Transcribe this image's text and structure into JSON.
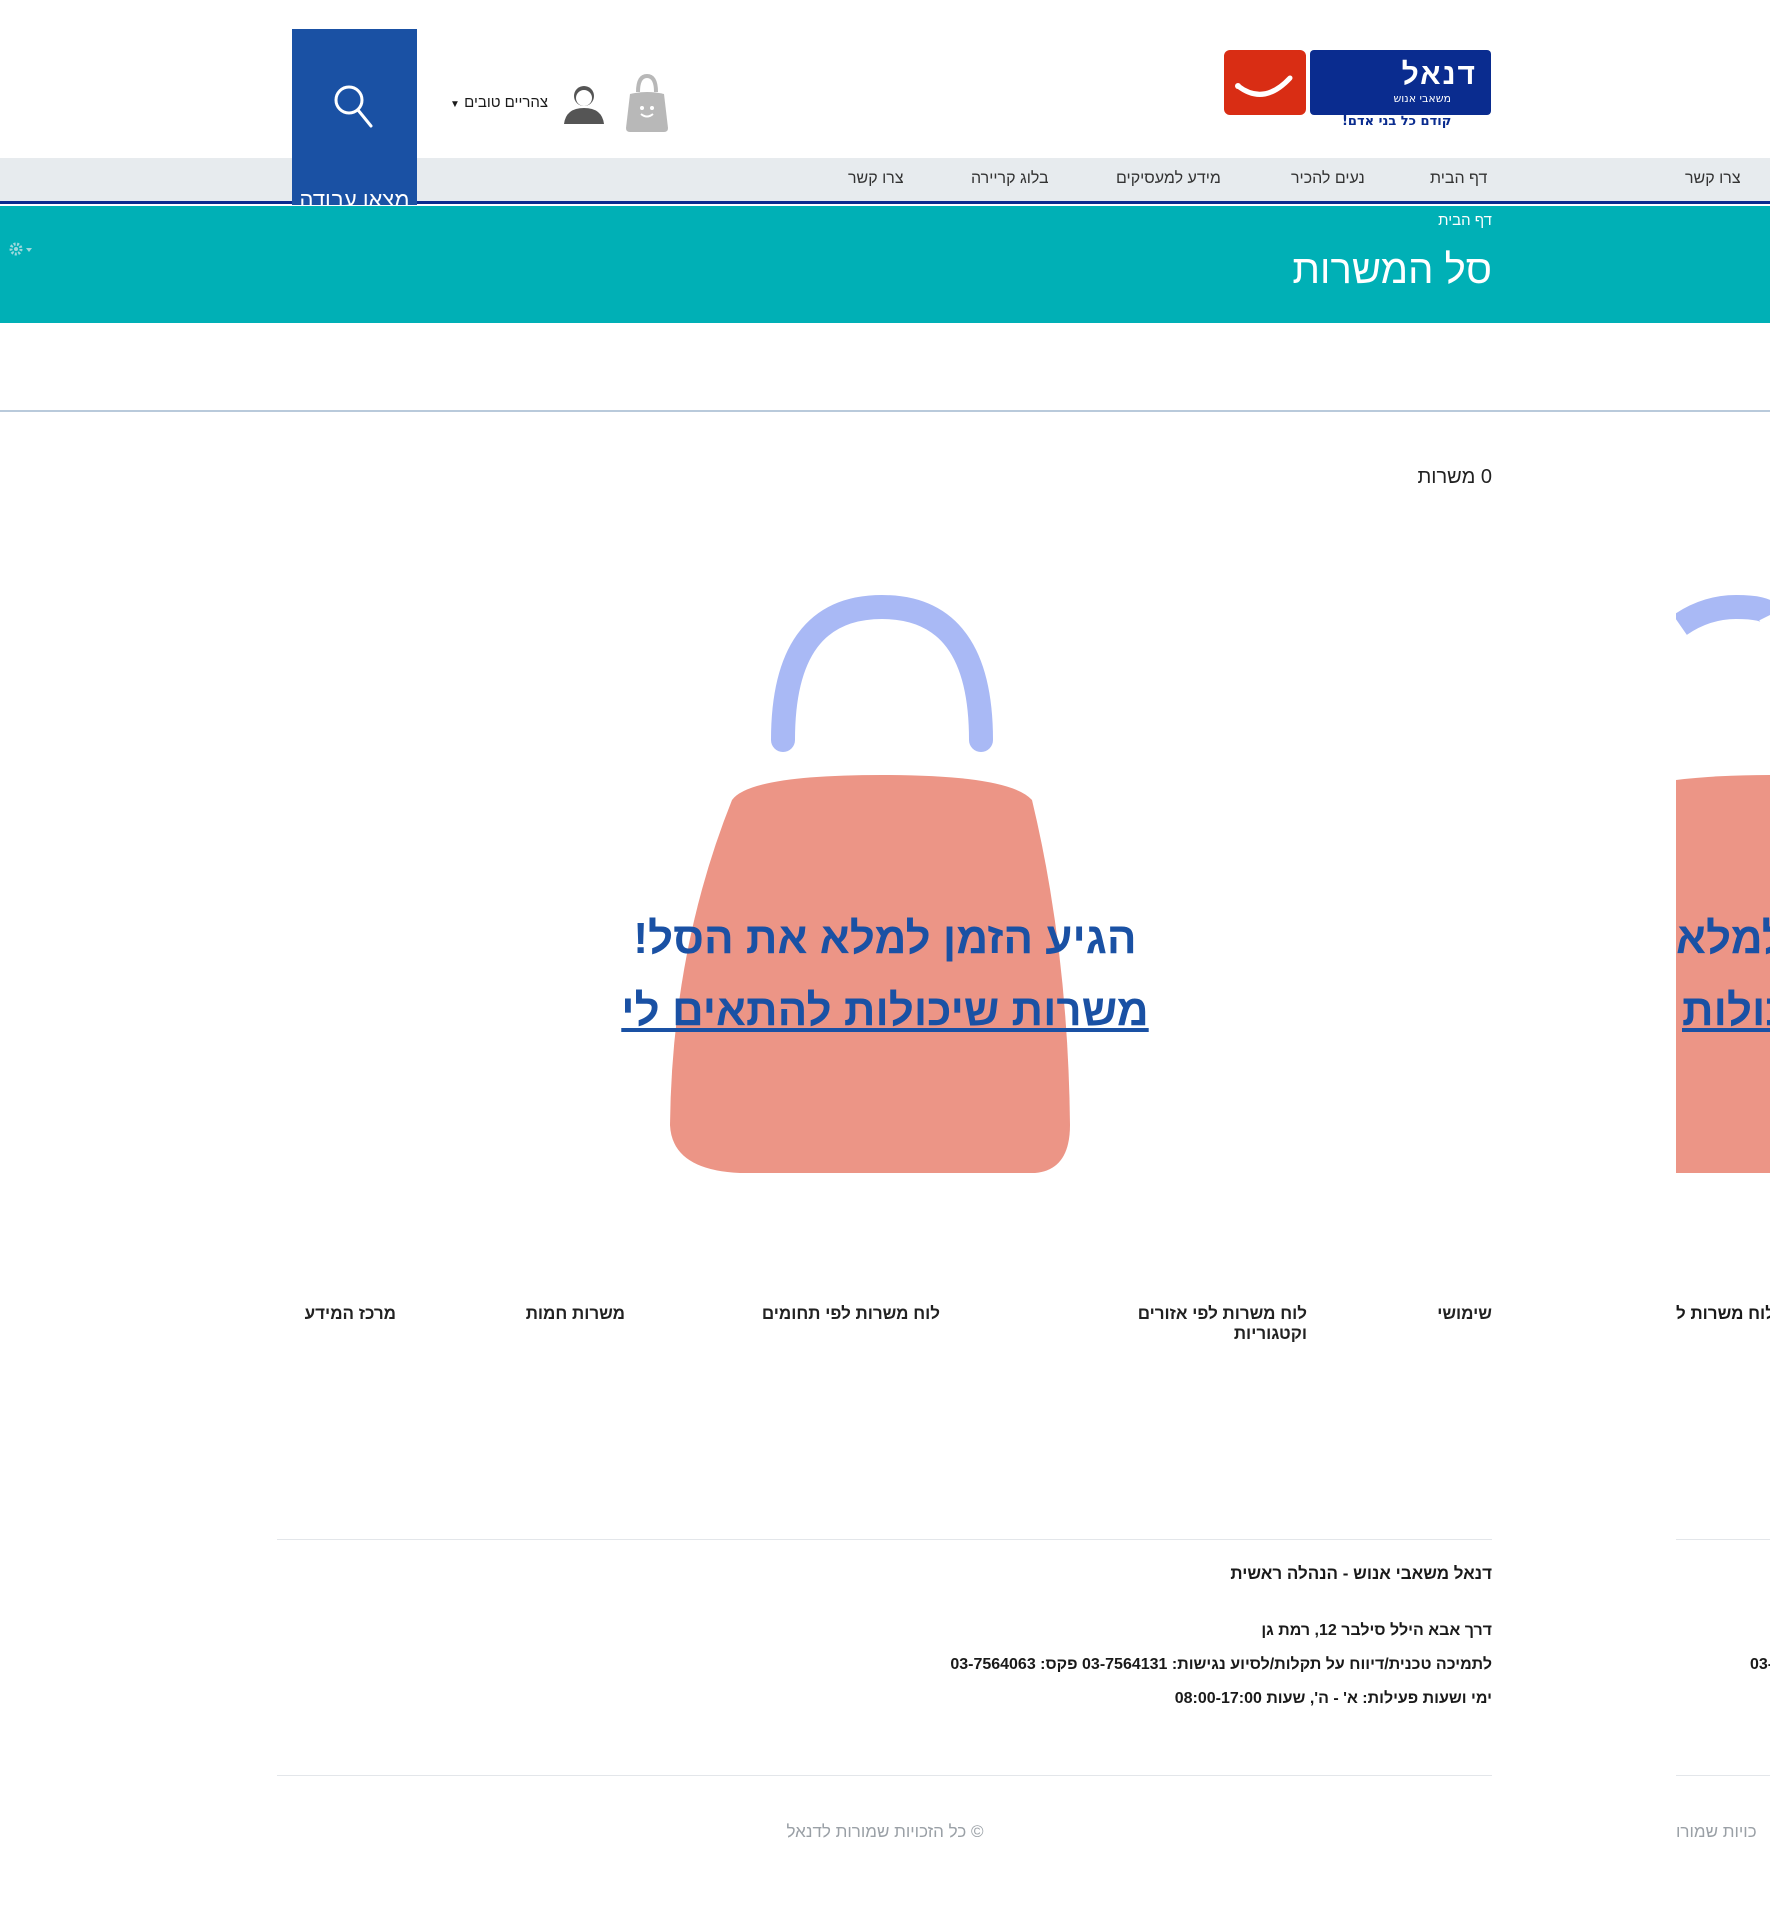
{
  "header": {
    "logo_brand": "דנאל",
    "logo_sub": "משאבי אנוש",
    "logo_tagline": "קודם כל בני אדם!",
    "greeting": "צהריים טובים",
    "find_job": "מצאו עבודה"
  },
  "nav": {
    "items": [
      "דף הבית",
      "נעים להכיר",
      "מידע למעסיקים",
      "בלוג קריירה",
      "צרו קשר"
    ],
    "far_right": "צרו קשר"
  },
  "page": {
    "breadcrumb": "דף הבית",
    "title": "סל המשרות",
    "job_count": "0 משרות"
  },
  "empty_state": {
    "title": "הגיע הזמן למלא את הסל!",
    "link": "משרות שיכולות להתאים לי"
  },
  "footer": {
    "links": [
      "שימושי",
      "לוח משרות לפי אזורים וקטגוריות",
      "לוח משרות לפי תחומים",
      "משרות חמות",
      "מרכז המידע"
    ],
    "company": "דנאל משאבי אנוש - הנהלה ראשית",
    "address": "דרך אבא הילל סילבר 12, רמת גן",
    "support": "לתמיכה טכנית/דיווח על תקלות/לסיוע נגישות: 03-7564131 פקס: 03-7564063",
    "hours": "ימי ושעות פעילות: א' - ה', שעות 08:00-17:00",
    "copyright": "© כל הזכויות שמורות לדנאל"
  },
  "ghost": {
    "link_fragment": "לוח משרות ל",
    "title_fragment": "למלא",
    "link2_fragment": "כולות",
    "phone_fragment": "03-",
    "copyright_fragment": "כויות שמורו"
  },
  "colors": {
    "brand_blue": "#0a2c8f",
    "button_blue": "#1a51a4",
    "teal": "#00b0b6",
    "bag_body": "#ec9586",
    "bag_handle": "#a9b9f5",
    "smile_red": "#d92d14"
  },
  "icons": [
    "shopping-bag-icon",
    "user-avatar-icon",
    "search-icon",
    "gear-icon",
    "smile-logo-icon"
  ]
}
